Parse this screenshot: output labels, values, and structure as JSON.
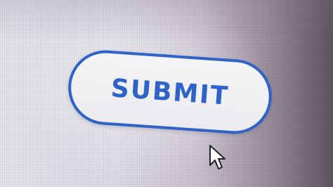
{
  "button": {
    "label": "SUBMIT",
    "accent_color": "#2f63c8"
  },
  "cursor": {
    "icon": "arrow-cursor-icon"
  }
}
